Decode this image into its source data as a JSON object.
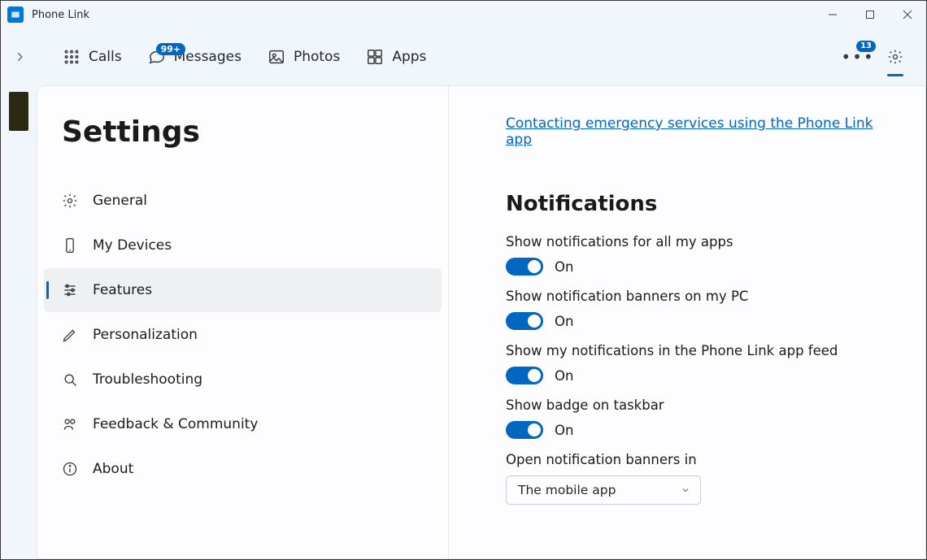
{
  "app": {
    "title": "Phone Link"
  },
  "nav": {
    "items": [
      {
        "label": "Calls",
        "badge": ""
      },
      {
        "label": "Messages",
        "badge": "99+"
      },
      {
        "label": "Photos",
        "badge": ""
      },
      {
        "label": "Apps",
        "badge": ""
      }
    ],
    "settings_badge": "13"
  },
  "sidebar": {
    "heading": "Settings",
    "items": [
      {
        "label": "General"
      },
      {
        "label": "My Devices"
      },
      {
        "label": "Features"
      },
      {
        "label": "Personalization"
      },
      {
        "label": "Troubleshooting"
      },
      {
        "label": "Feedback & Community"
      },
      {
        "label": "About"
      }
    ]
  },
  "main": {
    "emergency_link": "Contacting emergency services using the Phone Link app",
    "section_title": "Notifications",
    "toggles": [
      {
        "label": "Show notifications for all my apps",
        "state": "On"
      },
      {
        "label": "Show notification banners on my PC",
        "state": "On"
      },
      {
        "label": "Show my notifications in the Phone Link app feed",
        "state": "On"
      },
      {
        "label": "Show badge on taskbar",
        "state": "On"
      }
    ],
    "banner_open": {
      "label": "Open notification banners in",
      "value": "The mobile app"
    }
  }
}
